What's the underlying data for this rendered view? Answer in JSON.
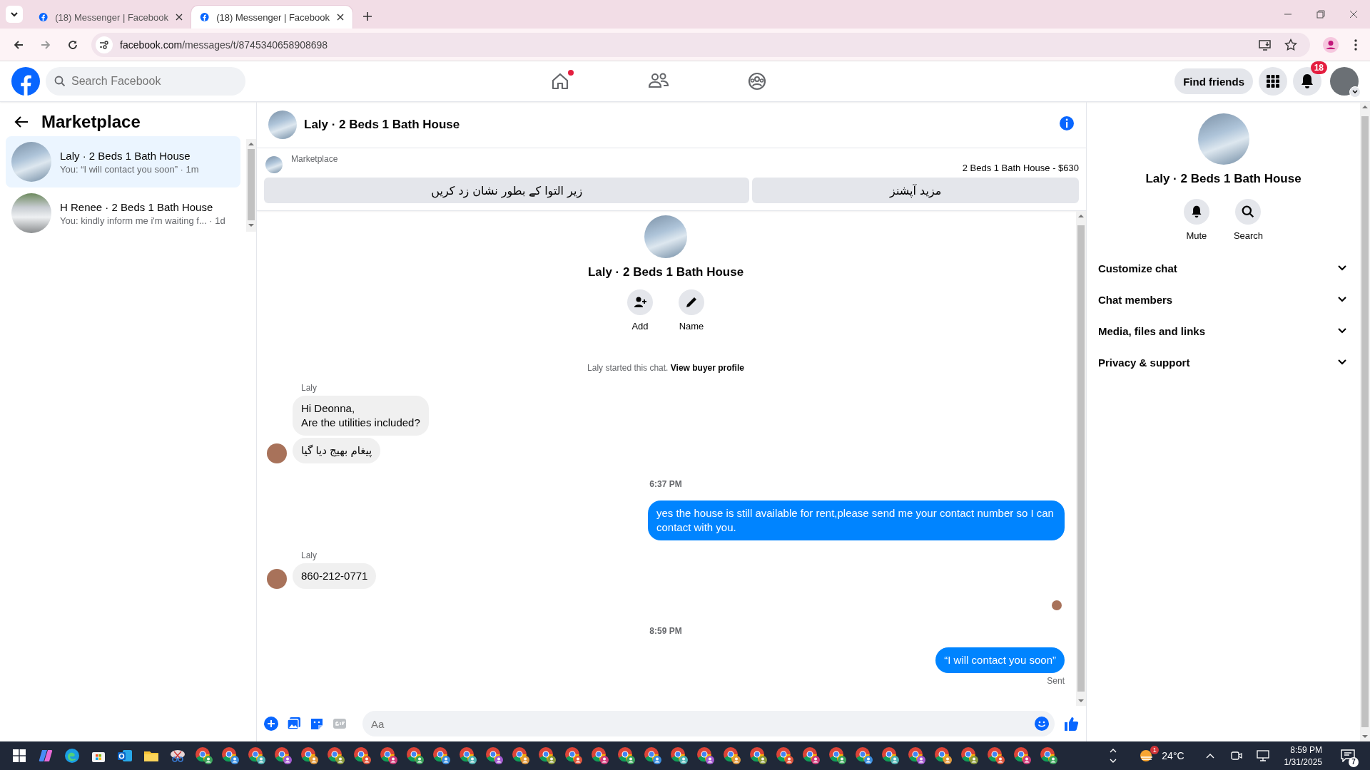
{
  "browser": {
    "tabs": [
      {
        "title": "(18) Messenger | Facebook",
        "selected": false
      },
      {
        "title": "(18) Messenger | Facebook",
        "selected": true
      }
    ],
    "url_domain": "facebook.com",
    "url_path": "/messages/t/8745340658908698"
  },
  "header": {
    "search_placeholder": "Search Facebook",
    "home_has_dot": true,
    "find_friends": "Find friends",
    "notification_count": "18"
  },
  "sidebar": {
    "title": "Marketplace",
    "conversations": [
      {
        "name": "Laly · 2 Beds 1 Bath House",
        "preview": "You: “I will contact you soon” · 1m",
        "selected": true
      },
      {
        "name": "H Renee · 2 Beds 1 Bath House",
        "preview": "You: kindly inform me i'm waiting f... · 1d",
        "selected": false
      }
    ]
  },
  "chat": {
    "title": "Laly · 2 Beds 1 Bath House",
    "listing": {
      "source": "Marketplace",
      "item": "2 Beds 1 Bath House - $630",
      "buttons": [
        "مزید آپشنز",
        "زیر التوا کے بطور نشان زد کریں"
      ]
    },
    "intro": {
      "name": "Laly · 2 Beds 1 Bath House",
      "actions": [
        {
          "kind": "add",
          "label": "Add"
        },
        {
          "kind": "name",
          "label": "Name"
        }
      ]
    },
    "messages": [
      {
        "kind": "system",
        "text": "Laly started this chat.",
        "link": "View buyer profile"
      },
      {
        "kind": "incoming",
        "sender": "Laly",
        "bubbles": [
          "Hi Deonna,\nAre the utilities included?",
          "پیغام بھیج دیا گیا"
        ]
      },
      {
        "kind": "time",
        "text": "6:37 PM"
      },
      {
        "kind": "outgoing",
        "bubbles": [
          "yes the house is still available for rent,please send me your contact number so I can contact with you."
        ]
      },
      {
        "kind": "incoming",
        "sender": "Laly",
        "bubbles": [
          "860-212-0771"
        ]
      },
      {
        "kind": "seen"
      },
      {
        "kind": "time",
        "text": "8:59 PM"
      },
      {
        "kind": "outgoing",
        "bubbles": [
          "“I will contact you soon”"
        ],
        "status": "Sent"
      }
    ],
    "composer_placeholder": "Aa"
  },
  "details": {
    "name": "Laly · 2 Beds 1 Bath House",
    "actions": [
      {
        "kind": "mute",
        "label": "Mute"
      },
      {
        "kind": "search",
        "label": "Search"
      }
    ],
    "sections": [
      {
        "label": "Customize chat",
        "expanded": false
      },
      {
        "label": "Chat members",
        "expanded": false
      },
      {
        "label": "Media, files and links",
        "expanded": false
      },
      {
        "label": "Privacy & support",
        "expanded": false
      }
    ]
  },
  "taskbar": {
    "temperature": "24°C",
    "weather_badge": "1",
    "time": "8:59 PM",
    "date": "1/31/2025",
    "notification_count": "7"
  }
}
